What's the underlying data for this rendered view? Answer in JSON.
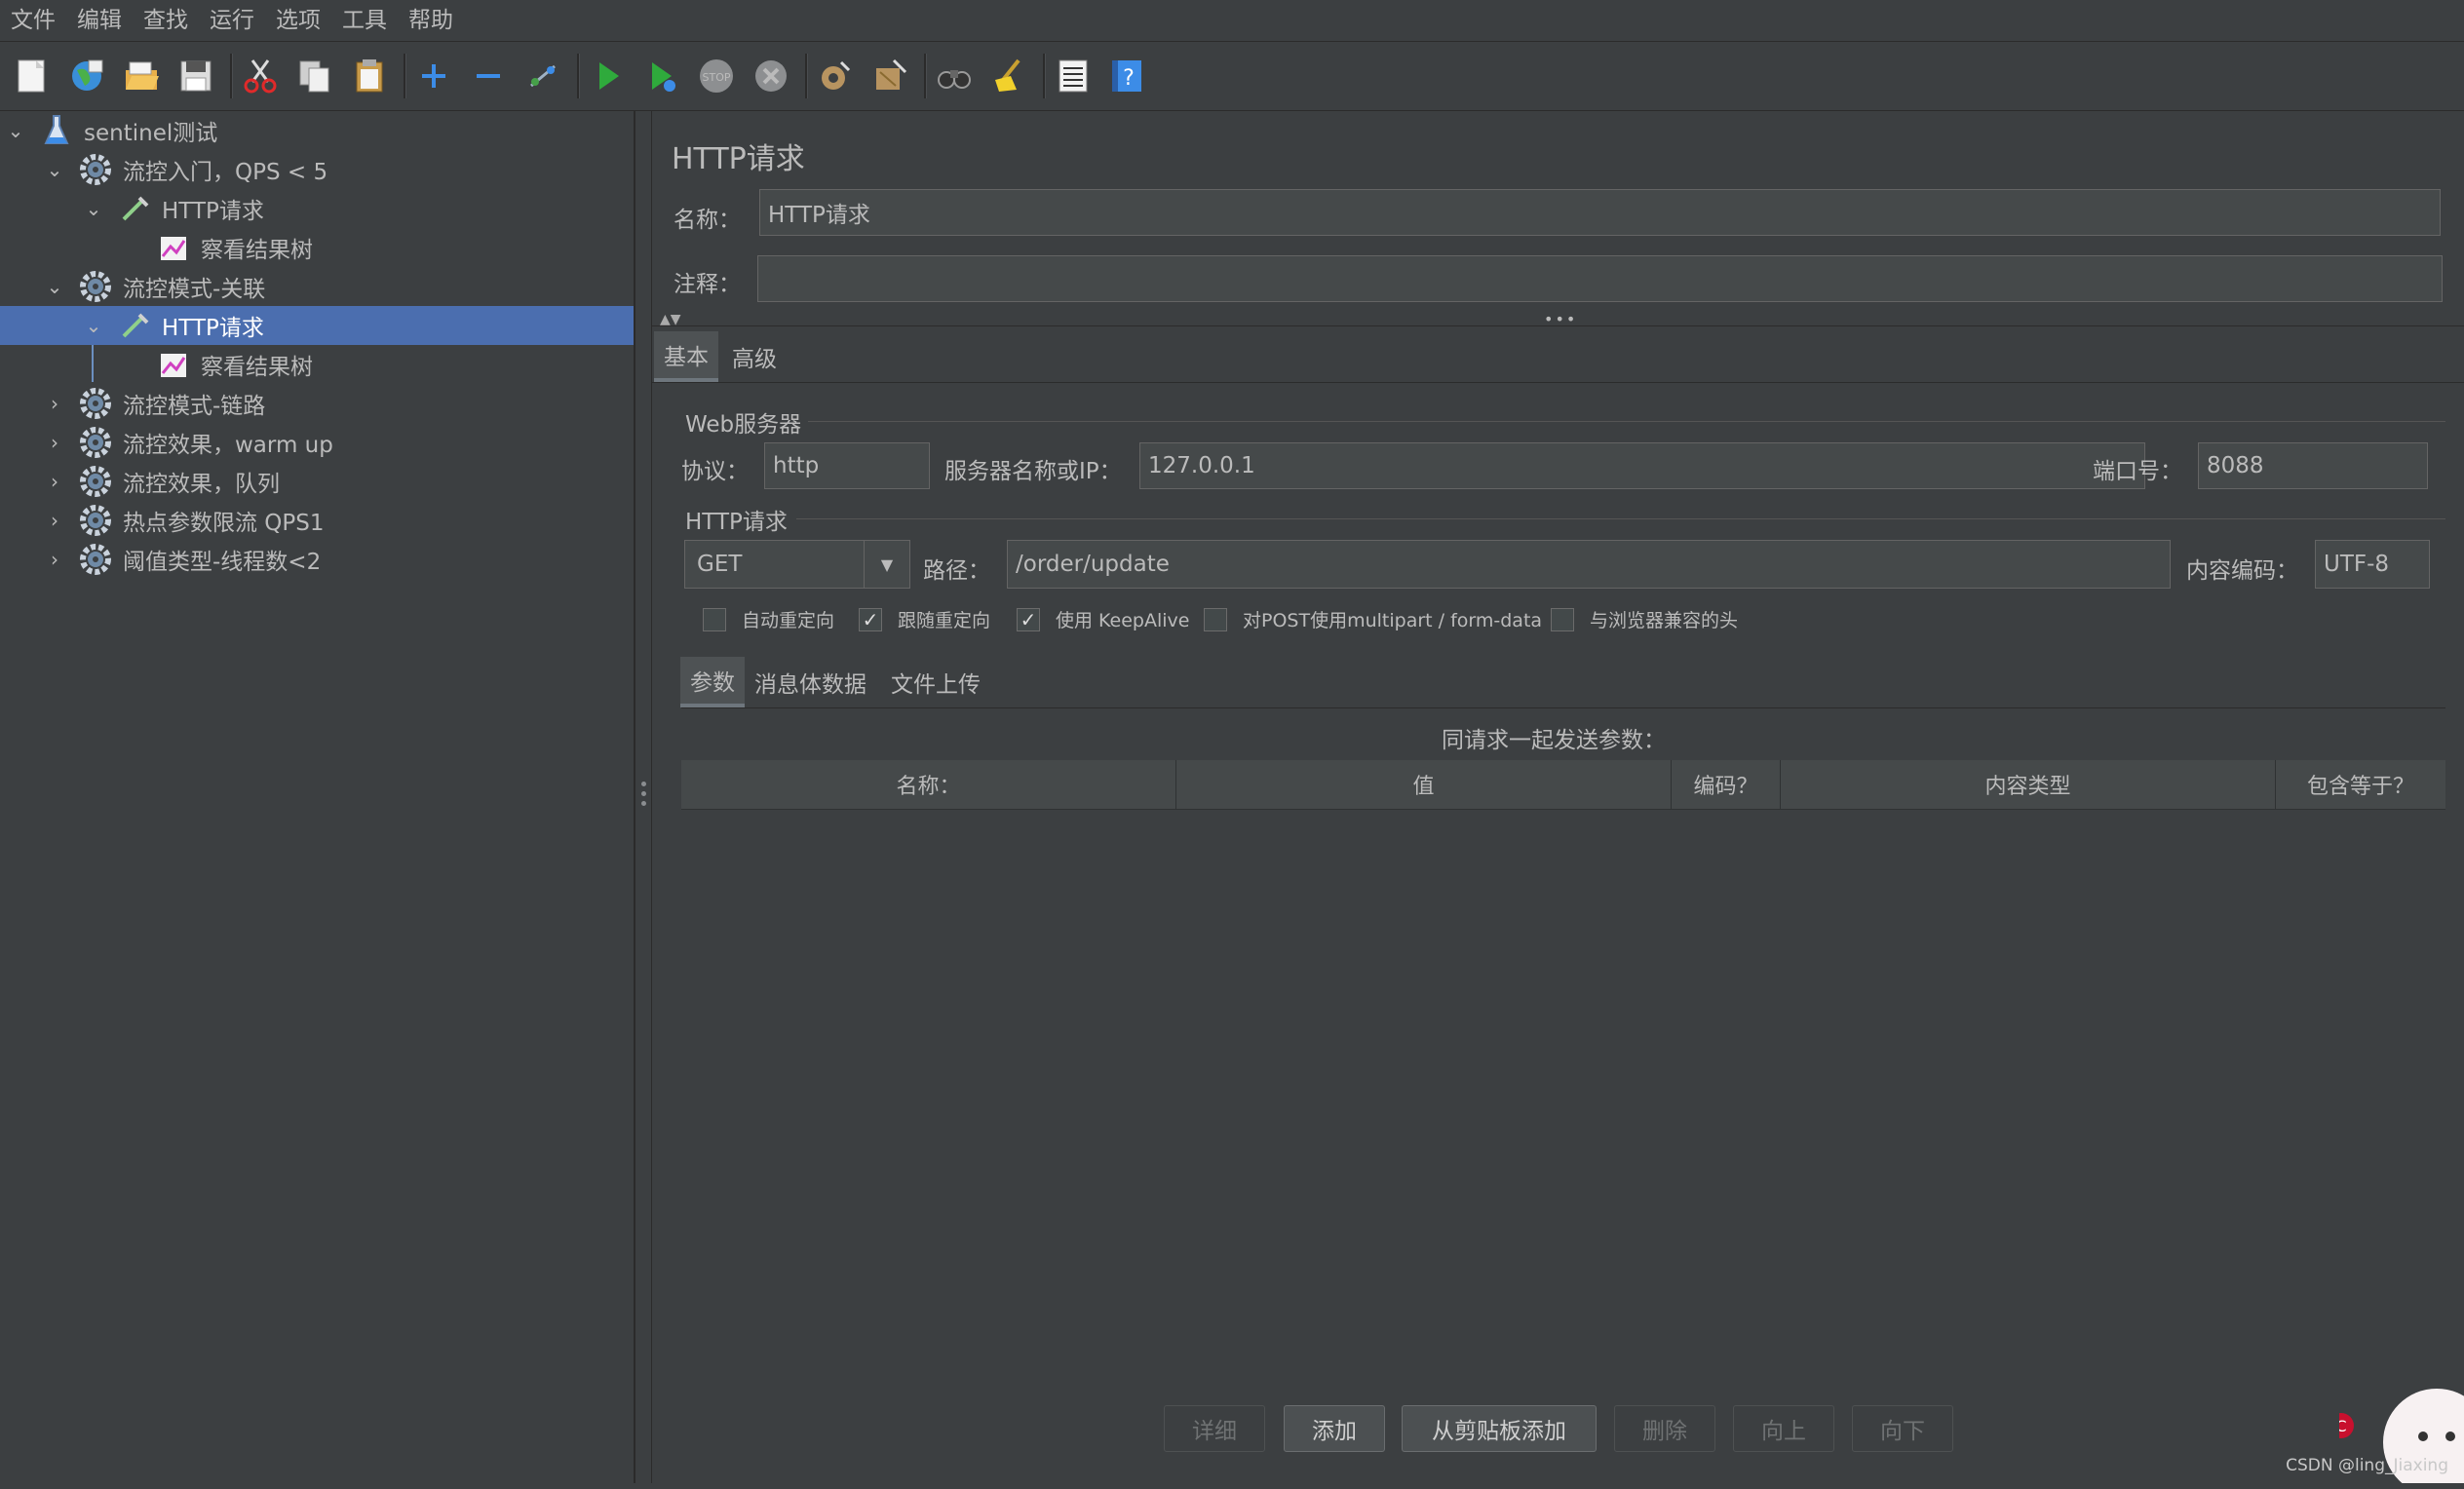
{
  "menu": [
    "文件",
    "编辑",
    "查找",
    "运行",
    "选项",
    "工具",
    "帮助"
  ],
  "toolbar_icons": [
    "new-icon",
    "templates-icon",
    "open-icon",
    "save-icon",
    "cut-icon",
    "copy-icon",
    "paste-icon",
    "expand-icon",
    "collapse-icon",
    "toggle-icon",
    "start-icon",
    "start-no-pauses-icon",
    "stop-icon",
    "shutdown-icon",
    "clear-icon",
    "clear-all-icon",
    "search-icon",
    "reset-search-icon",
    "function-helper-icon",
    "help-icon"
  ],
  "tree": {
    "root": "sentinel测试",
    "items": [
      {
        "label": "流控入门，QPS < 5"
      },
      {
        "label": "HTTP请求"
      },
      {
        "label": "察看结果树"
      },
      {
        "label": "流控模式-关联"
      },
      {
        "label": "HTTP请求"
      },
      {
        "label": "察看结果树"
      },
      {
        "label": "流控模式-链路"
      },
      {
        "label": "流控效果，warm up"
      },
      {
        "label": "流控效果，队列"
      },
      {
        "label": "热点参数限流 QPS1"
      },
      {
        "label": "阈值类型-线程数<2"
      }
    ]
  },
  "sampler": {
    "title": "HTTP请求",
    "name_label": "名称：",
    "name_value": "HTTP请求",
    "comment_label": "注释：",
    "comment_value": ""
  },
  "tabs": {
    "basic": "基本",
    "advanced": "高级"
  },
  "web_server": {
    "group": "Web服务器",
    "protocol_label": "协议：",
    "protocol_value": "http",
    "server_label": "服务器名称或IP：",
    "server_value": "127.0.0.1",
    "port_label": "端口号：",
    "port_value": "8088"
  },
  "http_request": {
    "group": "HTTP请求",
    "method": "GET",
    "path_label": "路径：",
    "path_value": "/order/update",
    "encoding_label": "内容编码：",
    "encoding_value": "UTF-8"
  },
  "checkboxes": [
    {
      "label": "自动重定向",
      "checked": false
    },
    {
      "label": "跟随重定向",
      "checked": true
    },
    {
      "label": "使用 KeepAlive",
      "checked": true
    },
    {
      "label": "对POST使用multipart / form-data",
      "checked": false
    },
    {
      "label": "与浏览器兼容的头",
      "checked": false
    }
  ],
  "param_tabs": [
    "参数",
    "消息体数据",
    "文件上传"
  ],
  "params": {
    "caption": "同请求一起发送参数：",
    "columns": [
      "名称：",
      "值",
      "编码？",
      "内容类型",
      "包含等于？"
    ]
  },
  "buttons": {
    "detail": "详细",
    "add": "添加",
    "add_clipboard": "从剪贴板添加",
    "delete": "删除",
    "up": "向上",
    "down": "向下"
  },
  "watermark": "CSDN @ling_Jiaxing"
}
